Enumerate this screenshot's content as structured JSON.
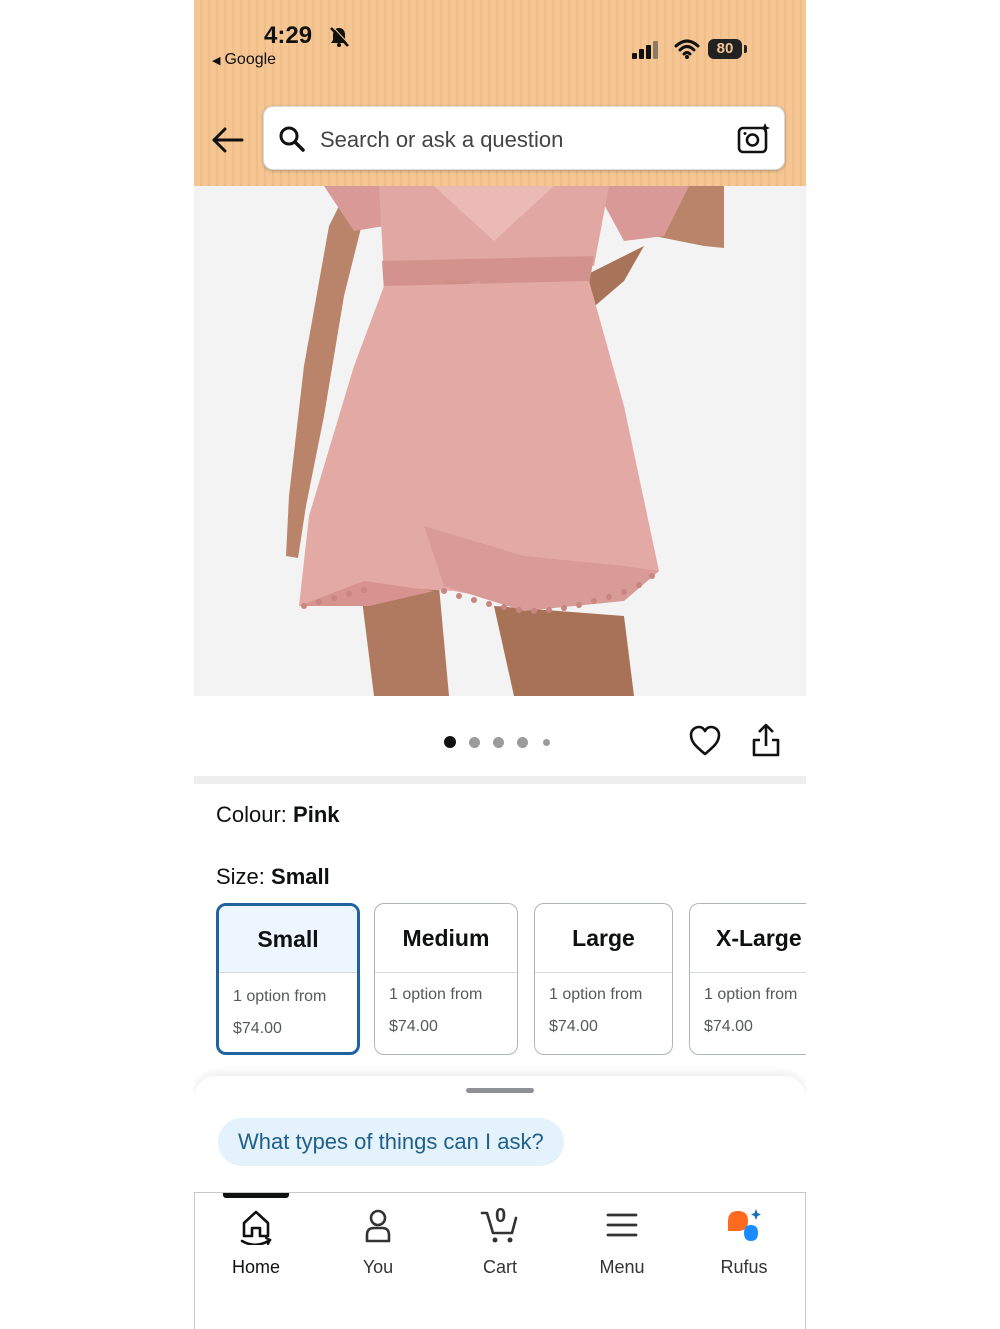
{
  "status_bar": {
    "time": "4:29",
    "back_app": "Google",
    "battery": "80"
  },
  "search": {
    "placeholder": "Search or ask a question"
  },
  "gallery": {
    "total_images": 5,
    "active_index": 0
  },
  "product": {
    "colour_label": "Colour:",
    "colour_value": "Pink",
    "size_label": "Size:",
    "size_value": "Small",
    "sizes": [
      {
        "name": "Small",
        "line1": "1 option from",
        "line2": "$74.00",
        "selected": true
      },
      {
        "name": "Medium",
        "line1": "1 option from",
        "line2": "$74.00",
        "selected": false
      },
      {
        "name": "Large",
        "line1": "1 option from",
        "line2": "$74.00",
        "selected": false
      },
      {
        "name": "X-Large",
        "line1": "1 option from",
        "line2": "$74.00",
        "selected": false
      }
    ]
  },
  "rufus": {
    "suggestion": "What types of things can I ask?"
  },
  "tabs": [
    {
      "label": "Home",
      "icon": "home-icon",
      "active": true
    },
    {
      "label": "You",
      "icon": "person-icon",
      "active": false
    },
    {
      "label": "Cart",
      "icon": "cart-icon",
      "badge": "0",
      "active": false
    },
    {
      "label": "Menu",
      "icon": "hamburger-menu-icon",
      "active": false
    },
    {
      "label": "Rufus",
      "icon": "rufus-icon",
      "active": false
    }
  ],
  "colors": {
    "header_bg": "#f5c693",
    "selected_border": "#2162a1",
    "chip_bg": "#e4f2fb",
    "chip_text": "#1f5f8b",
    "dress_pink": "#dfa4a0",
    "rufus_orange": "#ff6a1f",
    "rufus_blue": "#1a8cff"
  }
}
